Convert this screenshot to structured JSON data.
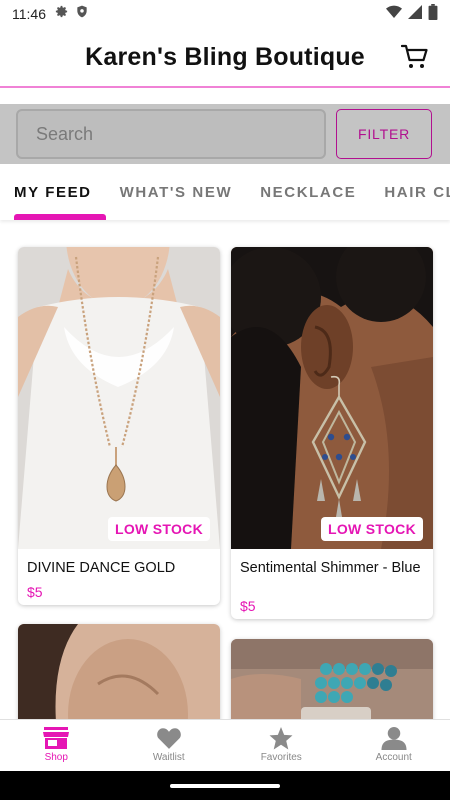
{
  "status": {
    "time": "11:46"
  },
  "header": {
    "title": "Karen's Bling Boutique"
  },
  "search": {
    "placeholder": "Search",
    "filter_label": "FILTER"
  },
  "tabs": [
    {
      "label": "MY FEED",
      "active": true
    },
    {
      "label": "WHAT'S NEW",
      "active": false
    },
    {
      "label": "NECKLACE",
      "active": false
    },
    {
      "label": "HAIR CLI",
      "active": false
    }
  ],
  "products": [
    {
      "name": "DIVINE DANCE GOLD",
      "price": "$5",
      "badge": "LOW STOCK"
    },
    {
      "name": "Sentimental Shimmer - Blue",
      "price": "$5",
      "badge": "LOW STOCK"
    }
  ],
  "nav": [
    {
      "label": "Shop",
      "icon": "store-icon",
      "active": true
    },
    {
      "label": "Waitlist",
      "icon": "heart-icon",
      "active": false
    },
    {
      "label": "Favorites",
      "icon": "star-icon",
      "active": false
    },
    {
      "label": "Account",
      "icon": "account-icon",
      "active": false
    }
  ],
  "colors": {
    "accent": "#e516b4",
    "filter_border": "#b1108f"
  }
}
